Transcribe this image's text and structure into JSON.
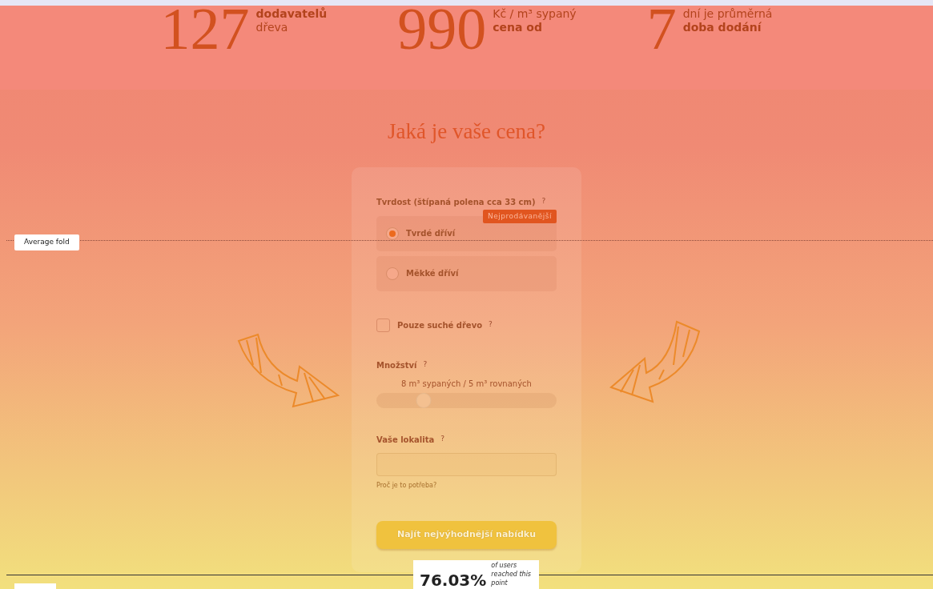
{
  "stats": [
    {
      "number": "127",
      "lines": [
        {
          "text": "dodavatelů",
          "bold": true
        },
        {
          "text": "dřeva",
          "bold": false
        }
      ]
    },
    {
      "number": "990",
      "lines": [
        {
          "text": "Kč / m³ sypaný",
          "bold": false
        },
        {
          "text": "cena od",
          "bold": true
        }
      ]
    },
    {
      "number": "7",
      "lines": [
        {
          "text": "dní je průměrná",
          "bold": false
        },
        {
          "text": "doba dodání",
          "bold": true
        }
      ]
    }
  ],
  "heading": "Jaká je vaše cena?",
  "form": {
    "hardness": {
      "label": "Tvrdost (štípaná polena cca 33 cm)",
      "help": "?",
      "options": [
        {
          "label": "Tvrdé dříví",
          "selected": true,
          "badge": "Nejprodávanější"
        },
        {
          "label": "Měkké dříví",
          "selected": false
        }
      ]
    },
    "dry_only": {
      "label": "Pouze suché dřevo",
      "help": "?",
      "checked": false
    },
    "quantity": {
      "label": "Množství",
      "help": "?",
      "reading": "8 m³ sypaných / 5 m³ rovnaných",
      "level": 0.26
    },
    "location": {
      "label": "Vaše lokalita",
      "help": "?",
      "hint": "Proč je to potřeba?"
    },
    "submit": "Najít nejvýhodnější nabídku"
  },
  "overlay": {
    "fold_label": "Average fold",
    "scroll_percent": "76.03%",
    "scroll_note": "of users reached this point"
  }
}
